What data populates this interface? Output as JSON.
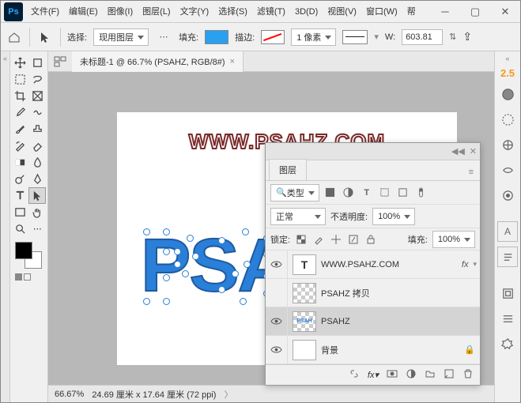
{
  "menu": [
    "文件(F)",
    "编辑(E)",
    "图像(I)",
    "图层(L)",
    "文字(Y)",
    "选择(S)",
    "滤镜(T)",
    "3D(D)",
    "视图(V)",
    "窗口(W)",
    "帮"
  ],
  "optbar": {
    "select_label": "选择:",
    "select_value": "现用图层",
    "fill_label": "填充:",
    "fill_color": "#2aa0f0",
    "stroke_label": "描边:",
    "stroke_width": "1 像素",
    "w_label": "W:",
    "w_value": "603.81"
  },
  "doc_tab": "未标题-1 @ 66.7% (PSAHZ, RGB/8#)",
  "canvas": {
    "watermark": "WWW.PSAHZ.COM",
    "edit_text": "PSA"
  },
  "status": {
    "zoom": "66.67%",
    "dims": "24.69 厘米 x 17.64 厘米 (72 ppi)"
  },
  "rightdock": {
    "badge": "2.5"
  },
  "panel": {
    "title": "图层",
    "filter_kind": "类型",
    "blend_mode": "正常",
    "opacity_label": "不透明度:",
    "opacity_value": "100%",
    "lock_label": "锁定:",
    "fill_label": "填充:",
    "fill_value": "100%",
    "layers": [
      {
        "name": "WWW.PSAHZ.COM",
        "type": "text",
        "fx": true
      },
      {
        "name": "PSAHZ 拷贝",
        "type": "raster"
      },
      {
        "name": "PSAHZ",
        "type": "smart",
        "selected": true
      },
      {
        "name": "背景",
        "type": "bg",
        "locked": true
      }
    ]
  }
}
